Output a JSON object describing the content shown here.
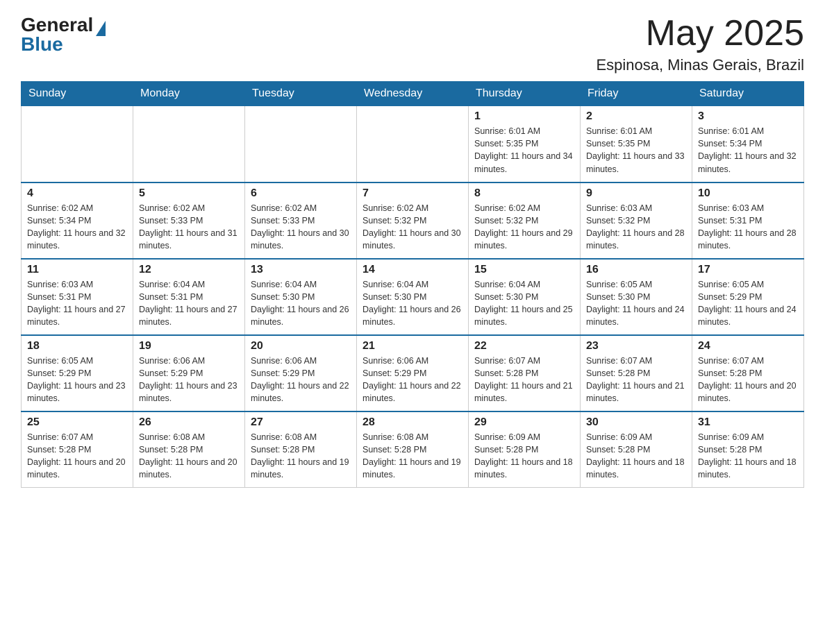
{
  "logo": {
    "general": "General",
    "blue": "Blue"
  },
  "header": {
    "month": "May 2025",
    "location": "Espinosa, Minas Gerais, Brazil"
  },
  "weekdays": [
    "Sunday",
    "Monday",
    "Tuesday",
    "Wednesday",
    "Thursday",
    "Friday",
    "Saturday"
  ],
  "weeks": [
    [
      {
        "day": "",
        "info": ""
      },
      {
        "day": "",
        "info": ""
      },
      {
        "day": "",
        "info": ""
      },
      {
        "day": "",
        "info": ""
      },
      {
        "day": "1",
        "info": "Sunrise: 6:01 AM\nSunset: 5:35 PM\nDaylight: 11 hours and 34 minutes."
      },
      {
        "day": "2",
        "info": "Sunrise: 6:01 AM\nSunset: 5:35 PM\nDaylight: 11 hours and 33 minutes."
      },
      {
        "day": "3",
        "info": "Sunrise: 6:01 AM\nSunset: 5:34 PM\nDaylight: 11 hours and 32 minutes."
      }
    ],
    [
      {
        "day": "4",
        "info": "Sunrise: 6:02 AM\nSunset: 5:34 PM\nDaylight: 11 hours and 32 minutes."
      },
      {
        "day": "5",
        "info": "Sunrise: 6:02 AM\nSunset: 5:33 PM\nDaylight: 11 hours and 31 minutes."
      },
      {
        "day": "6",
        "info": "Sunrise: 6:02 AM\nSunset: 5:33 PM\nDaylight: 11 hours and 30 minutes."
      },
      {
        "day": "7",
        "info": "Sunrise: 6:02 AM\nSunset: 5:32 PM\nDaylight: 11 hours and 30 minutes."
      },
      {
        "day": "8",
        "info": "Sunrise: 6:02 AM\nSunset: 5:32 PM\nDaylight: 11 hours and 29 minutes."
      },
      {
        "day": "9",
        "info": "Sunrise: 6:03 AM\nSunset: 5:32 PM\nDaylight: 11 hours and 28 minutes."
      },
      {
        "day": "10",
        "info": "Sunrise: 6:03 AM\nSunset: 5:31 PM\nDaylight: 11 hours and 28 minutes."
      }
    ],
    [
      {
        "day": "11",
        "info": "Sunrise: 6:03 AM\nSunset: 5:31 PM\nDaylight: 11 hours and 27 minutes."
      },
      {
        "day": "12",
        "info": "Sunrise: 6:04 AM\nSunset: 5:31 PM\nDaylight: 11 hours and 27 minutes."
      },
      {
        "day": "13",
        "info": "Sunrise: 6:04 AM\nSunset: 5:30 PM\nDaylight: 11 hours and 26 minutes."
      },
      {
        "day": "14",
        "info": "Sunrise: 6:04 AM\nSunset: 5:30 PM\nDaylight: 11 hours and 26 minutes."
      },
      {
        "day": "15",
        "info": "Sunrise: 6:04 AM\nSunset: 5:30 PM\nDaylight: 11 hours and 25 minutes."
      },
      {
        "day": "16",
        "info": "Sunrise: 6:05 AM\nSunset: 5:30 PM\nDaylight: 11 hours and 24 minutes."
      },
      {
        "day": "17",
        "info": "Sunrise: 6:05 AM\nSunset: 5:29 PM\nDaylight: 11 hours and 24 minutes."
      }
    ],
    [
      {
        "day": "18",
        "info": "Sunrise: 6:05 AM\nSunset: 5:29 PM\nDaylight: 11 hours and 23 minutes."
      },
      {
        "day": "19",
        "info": "Sunrise: 6:06 AM\nSunset: 5:29 PM\nDaylight: 11 hours and 23 minutes."
      },
      {
        "day": "20",
        "info": "Sunrise: 6:06 AM\nSunset: 5:29 PM\nDaylight: 11 hours and 22 minutes."
      },
      {
        "day": "21",
        "info": "Sunrise: 6:06 AM\nSunset: 5:29 PM\nDaylight: 11 hours and 22 minutes."
      },
      {
        "day": "22",
        "info": "Sunrise: 6:07 AM\nSunset: 5:28 PM\nDaylight: 11 hours and 21 minutes."
      },
      {
        "day": "23",
        "info": "Sunrise: 6:07 AM\nSunset: 5:28 PM\nDaylight: 11 hours and 21 minutes."
      },
      {
        "day": "24",
        "info": "Sunrise: 6:07 AM\nSunset: 5:28 PM\nDaylight: 11 hours and 20 minutes."
      }
    ],
    [
      {
        "day": "25",
        "info": "Sunrise: 6:07 AM\nSunset: 5:28 PM\nDaylight: 11 hours and 20 minutes."
      },
      {
        "day": "26",
        "info": "Sunrise: 6:08 AM\nSunset: 5:28 PM\nDaylight: 11 hours and 20 minutes."
      },
      {
        "day": "27",
        "info": "Sunrise: 6:08 AM\nSunset: 5:28 PM\nDaylight: 11 hours and 19 minutes."
      },
      {
        "day": "28",
        "info": "Sunrise: 6:08 AM\nSunset: 5:28 PM\nDaylight: 11 hours and 19 minutes."
      },
      {
        "day": "29",
        "info": "Sunrise: 6:09 AM\nSunset: 5:28 PM\nDaylight: 11 hours and 18 minutes."
      },
      {
        "day": "30",
        "info": "Sunrise: 6:09 AM\nSunset: 5:28 PM\nDaylight: 11 hours and 18 minutes."
      },
      {
        "day": "31",
        "info": "Sunrise: 6:09 AM\nSunset: 5:28 PM\nDaylight: 11 hours and 18 minutes."
      }
    ]
  ]
}
